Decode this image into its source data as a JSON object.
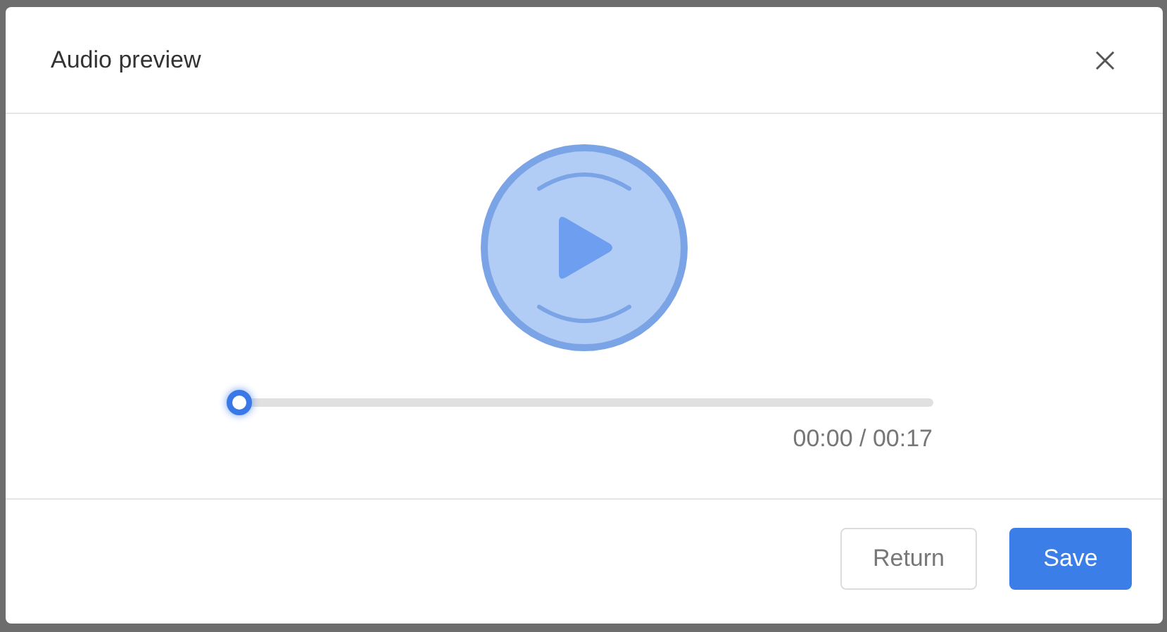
{
  "dialog": {
    "title": "Audio preview"
  },
  "player": {
    "playing": false,
    "progress": {
      "level": 0
    },
    "time": "00:00 / 00:17"
  },
  "buttons": [
    {
      "label": "Return",
      "kind": "secondary"
    },
    {
      "label": "Save",
      "kind": "primary"
    }
  ]
}
